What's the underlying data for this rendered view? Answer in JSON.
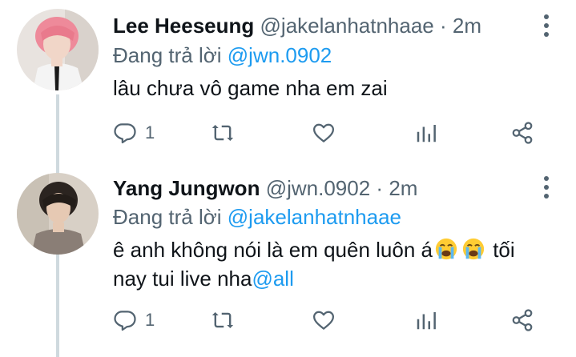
{
  "tweets": [
    {
      "name": "Lee Heeseung",
      "handle": "@jakelanhatnhaae",
      "dot": "·",
      "time": "2m",
      "replying_prefix": "Đang trả lời ",
      "replying_to": "@jwn.0902",
      "text": "lâu chưa vô game nha em zai",
      "reply_count": "1",
      "retweet_count": "",
      "like_count": "",
      "avatar_icon": "avatar-photo-pink-hair"
    },
    {
      "name": "Yang Jungwon",
      "handle": "@jwn.0902",
      "dot": "·",
      "time": "2m",
      "replying_prefix": "Đang trả lời ",
      "replying_to": "@jakelanhatnhaae",
      "text_part1": "ê anh không nói là em quên luôn á",
      "emoji_icon": "loudly-crying-face-emoji",
      "text_part2": " tối nay tui live nha",
      "text_mention": "@all",
      "reply_count": "1",
      "retweet_count": "",
      "like_count": "",
      "avatar_icon": "avatar-photo-dark-hair"
    }
  ],
  "colors": {
    "text": "#0f1419",
    "secondary": "#536471",
    "accent": "#1d9bf0",
    "thread_line": "#cfd9de"
  }
}
